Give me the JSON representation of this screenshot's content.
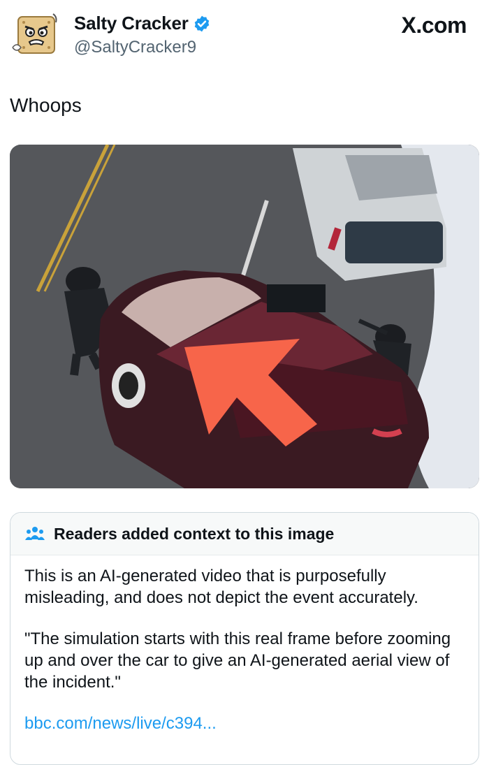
{
  "author": {
    "display_name": "Salty Cracker",
    "handle": "@SaltyCracker9",
    "verified": true,
    "avatar_icon": "cracker-mascot-icon"
  },
  "brand": {
    "label": "X.com"
  },
  "tweet": {
    "text": "Whoops"
  },
  "media": {
    "alt_hint": "aerial-photo-police-car-with-red-arrow"
  },
  "community_note": {
    "title": "Readers added context to this image",
    "paragraph1": "This is an AI-generated video that is purposefully misleading, and does not depict the event accurately.",
    "paragraph2": "\"The simulation starts with this real frame before zooming up and over the car to give an AI-generated aerial view of the incident.\"",
    "link": "bbc.com/news/live/c394..."
  },
  "colors": {
    "verified_blue": "#1d9bf0",
    "link_blue": "#1d9bf0",
    "arrow": "#f7654a",
    "note_header_bg": "#f7f9f9"
  }
}
